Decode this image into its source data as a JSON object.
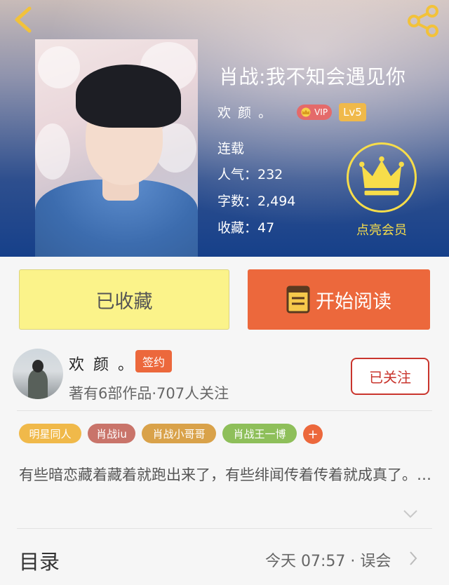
{
  "header": {
    "book_title": "肖战:我不知会遇见你",
    "author": "欢 颜 。",
    "vip_label": "VIP",
    "level": "Lv5",
    "status": "连载",
    "popularity": "人气：232",
    "word_count": "字数：2,494",
    "favorites": "收藏：47",
    "member_label": "点亮会员"
  },
  "actions": {
    "collect_label": "已收藏",
    "read_label": "开始阅读"
  },
  "author_section": {
    "name": "欢 颜 。",
    "sign_badge": "签约",
    "meta": "著有6部作品·707人关注",
    "follow_label": "已关注"
  },
  "tags": [
    {
      "label": "明星同人",
      "color": "#f0b94a"
    },
    {
      "label": "肖战iu",
      "color": "#c9746a"
    },
    {
      "label": "肖战小哥哥",
      "color": "#d9a24a"
    },
    {
      "label": "肖战王一博",
      "color": "#8ebf5a"
    }
  ],
  "tag_add_label": "+",
  "intro": "有些暗恋藏着藏着就跑出来了，有些绯闻传着传着就成真了。…",
  "catalog": {
    "label": "目录",
    "latest": "今天 07:57 · 误会"
  },
  "colors": {
    "accent": "#ec683c",
    "collect_bg": "#fbf38a",
    "member_gold": "#f7dd4a",
    "follow_red": "#c9352d"
  },
  "icons": [
    "back-arrow-icon",
    "share-icon",
    "crown-icon",
    "book-icon",
    "chevron-down-icon",
    "chevron-right-icon"
  ]
}
